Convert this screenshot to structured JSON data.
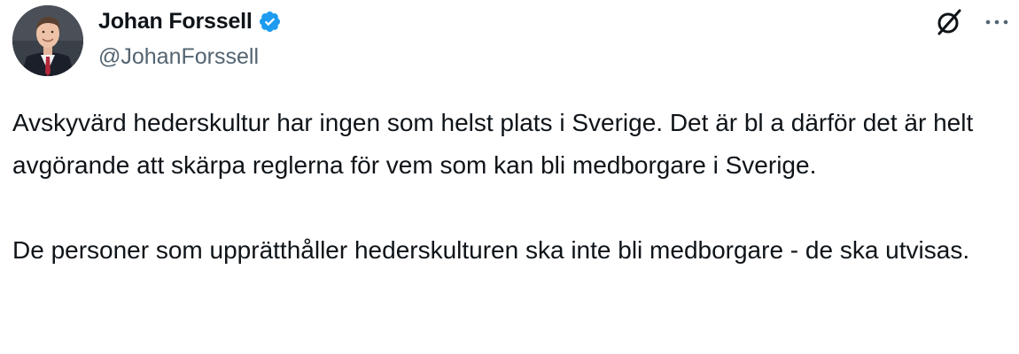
{
  "author": {
    "display_name": "Johan Forssell",
    "handle": "@JohanForssell",
    "verified": true,
    "avatar_icon": "avatar-photo"
  },
  "actions": {
    "grok_icon": "grok-icon",
    "more_icon": "more-icon"
  },
  "tweet": {
    "paragraphs": [
      "Avskyvärd hederskultur har ingen som helst plats i Sverige. Det är bl a därför det är helt avgörande att skärpa reglerna för vem som kan bli medborgare i Sverige.",
      "De personer som upprätthåller hederskulturen ska inte bli medborgare - de ska utvisas."
    ]
  },
  "colors": {
    "text": "#0f1419",
    "secondary": "#536471",
    "verified_blue": "#1d9bf0"
  }
}
